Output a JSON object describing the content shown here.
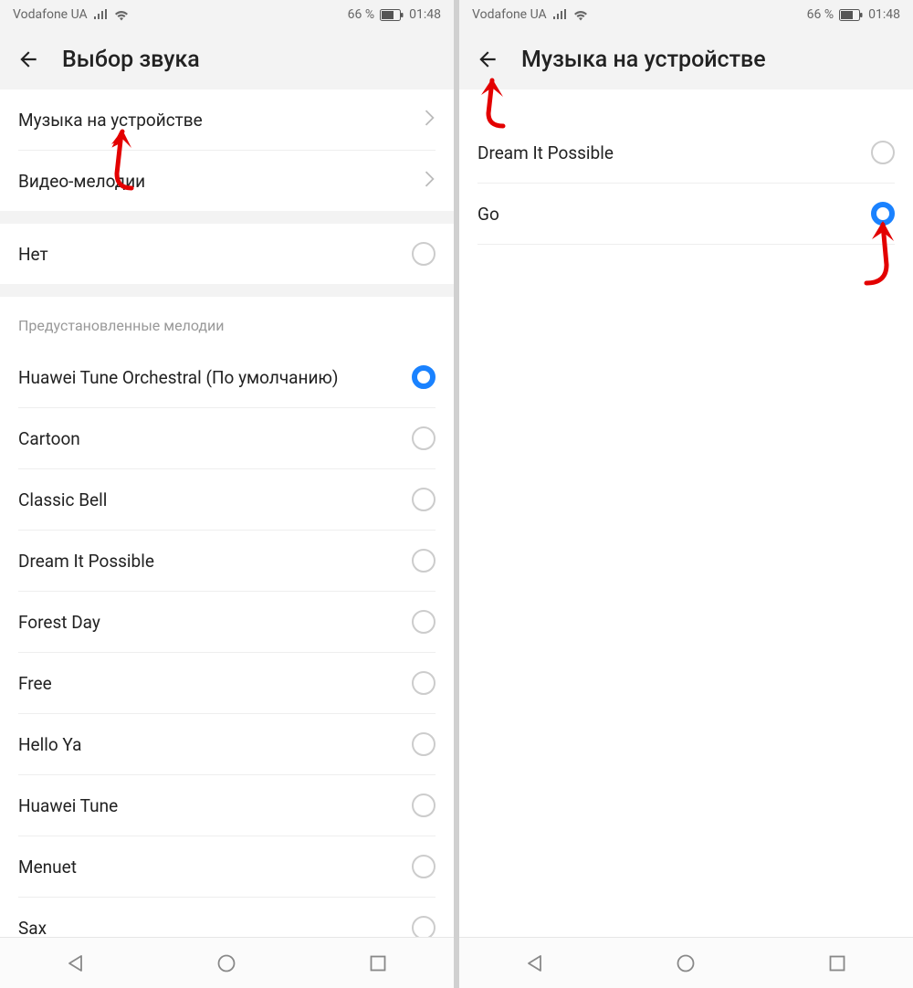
{
  "status": {
    "carrier": "Vodafone UA",
    "battery_pct": "66 %",
    "time": "01:48"
  },
  "left": {
    "title": "Выбор звука",
    "nav": [
      {
        "label": "Музыка на устройстве"
      },
      {
        "label": "Видео-мелодии"
      }
    ],
    "none_label": "Нет",
    "section_header": "Предустановленные мелодии",
    "ringtones": [
      {
        "label": "Huawei Tune Orchestral (По умолчанию)",
        "selected": true
      },
      {
        "label": "Cartoon",
        "selected": false
      },
      {
        "label": "Classic Bell",
        "selected": false
      },
      {
        "label": "Dream It Possible",
        "selected": false
      },
      {
        "label": "Forest Day",
        "selected": false
      },
      {
        "label": "Free",
        "selected": false
      },
      {
        "label": "Hello Ya",
        "selected": false
      },
      {
        "label": "Huawei Tune",
        "selected": false
      },
      {
        "label": "Menuet",
        "selected": false
      },
      {
        "label": "Sax",
        "selected": false
      }
    ]
  },
  "right": {
    "title": "Музыка на устройстве",
    "songs": [
      {
        "label": "Dream It Possible",
        "selected": false
      },
      {
        "label": "Go",
        "selected": true
      }
    ]
  }
}
